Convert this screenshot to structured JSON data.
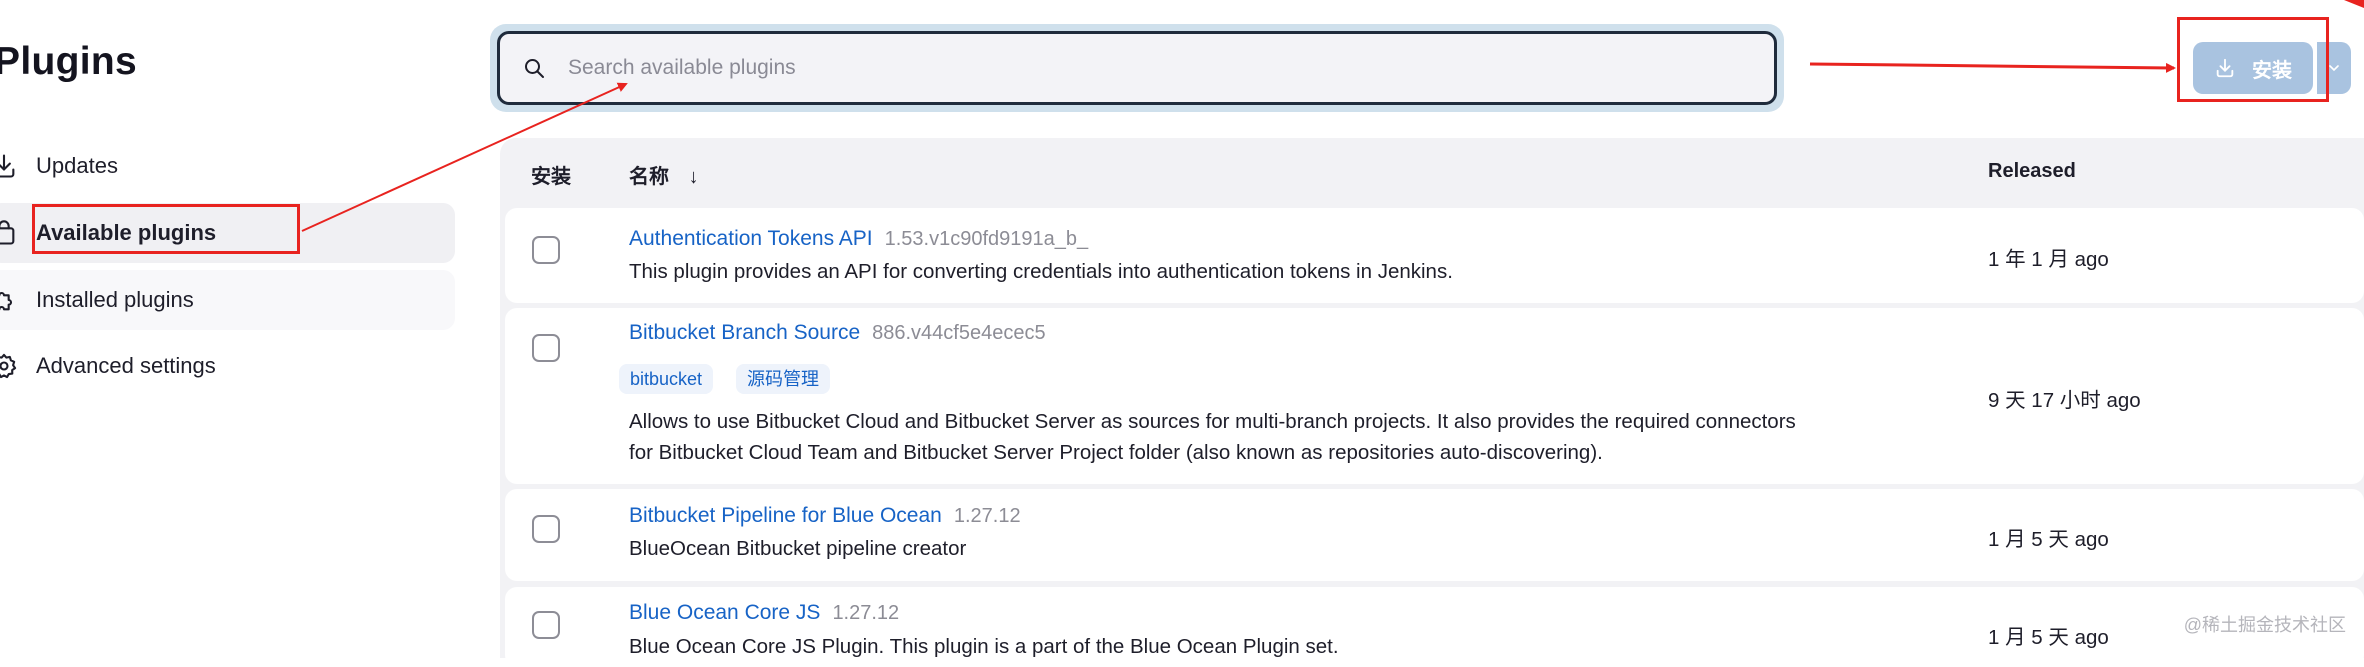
{
  "page": {
    "title": "Plugins"
  },
  "sidebar": {
    "items": [
      {
        "label": "Updates",
        "icon": "download-icon"
      },
      {
        "label": "Available plugins",
        "icon": "shopping-bag-icon"
      },
      {
        "label": "Installed plugins",
        "icon": "puzzle-icon"
      },
      {
        "label": "Advanced settings",
        "icon": "gear-icon"
      }
    ]
  },
  "search": {
    "placeholder": "Search available plugins",
    "value": ""
  },
  "toolbar": {
    "install_label": "安装"
  },
  "table": {
    "headers": {
      "install": "安装",
      "name": "名称",
      "sort": "↓",
      "released": "Released"
    },
    "rows": [
      {
        "name": "Authentication Tokens API",
        "version": "1.53.v1c90fd9191a_b_",
        "tags": [],
        "description": "This plugin provides an API for converting credentials into authentication tokens in Jenkins.",
        "description2": "",
        "released": "1 年 1 月 ago"
      },
      {
        "name": "Bitbucket Branch Source",
        "version": "886.v44cf5e4ecec5",
        "tags": [
          "bitbucket",
          "源码管理"
        ],
        "description": "Allows to use Bitbucket Cloud and Bitbucket Server as sources for multi-branch projects. It also provides the required connectors",
        "description2": "for Bitbucket Cloud Team and Bitbucket Server Project folder (also known as repositories auto-discovering).",
        "released": "9 天 17 小时 ago"
      },
      {
        "name": "Bitbucket Pipeline for Blue Ocean",
        "version": "1.27.12",
        "tags": [],
        "description": "BlueOcean Bitbucket pipeline creator",
        "description2": "",
        "released": "1 月 5 天 ago"
      },
      {
        "name": "Blue Ocean Core JS",
        "version": "1.27.12",
        "tags": [],
        "description": "Blue Ocean Core JS Plugin. This plugin is a part of the Blue Ocean Plugin set.",
        "description2": "",
        "released": "1 月 5 天 ago"
      }
    ]
  },
  "watermark": "@稀土掘金技术社区",
  "colors": {
    "accent": "#1763c6",
    "annotation": "#e8231f",
    "install_button": "#a9c3e0"
  }
}
